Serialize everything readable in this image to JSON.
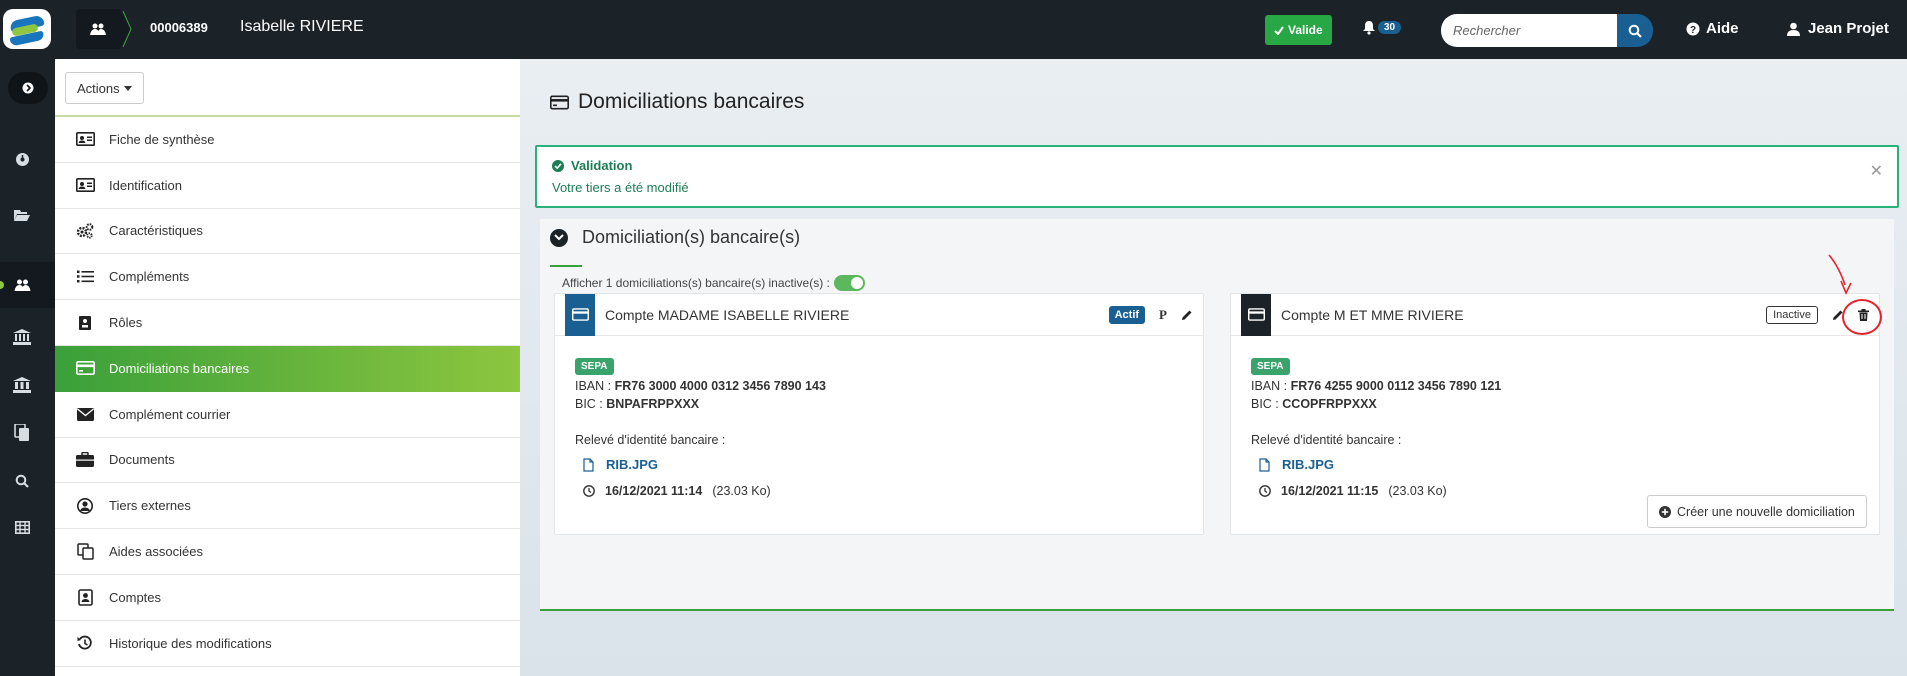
{
  "header": {
    "tiers_number": "00006389",
    "tiers_name": "Isabelle RIVIERE",
    "status_label": "Valide",
    "notifications_count": "30",
    "search_placeholder": "Rechercher",
    "help_label": "Aide",
    "user_name": "Jean Projet"
  },
  "sidebar": {
    "actions_label": "Actions",
    "items": [
      {
        "label": "Fiche de synthèse",
        "icon": "id-card-icon"
      },
      {
        "label": "Identification",
        "icon": "id-card-icon"
      },
      {
        "label": "Caractéristiques",
        "icon": "cogs-icon"
      },
      {
        "label": "Compléments",
        "icon": "list-icon"
      },
      {
        "label": "Rôles",
        "icon": "role-icon"
      },
      {
        "label": "Domiciliations bancaires",
        "icon": "credit-card-icon",
        "active": true
      },
      {
        "label": "Complément courrier",
        "icon": "envelope-icon"
      },
      {
        "label": "Documents",
        "icon": "briefcase-icon"
      },
      {
        "label": "Tiers externes",
        "icon": "user-circle-icon"
      },
      {
        "label": "Aides associées",
        "icon": "copy-icon"
      },
      {
        "label": "Comptes",
        "icon": "address-card-icon"
      },
      {
        "label": "Historique des modifications",
        "icon": "history-icon"
      }
    ]
  },
  "main": {
    "page_title": "Domiciliations bancaires",
    "alert": {
      "title": "Validation",
      "message": "Votre tiers a été modifié"
    },
    "panel": {
      "title": "Domiciliation(s) bancaire(s)",
      "toggle_label": "Afficher 1 domiciliations(s) bancaire(s) inactive(s) :",
      "create_label": "Créer une nouvelle domiciliation"
    },
    "accounts": [
      {
        "title": "Compte MADAME ISABELLE RIVIERE",
        "status": "Actif",
        "principal": "P",
        "type": "SEPA",
        "iban_label": "IBAN :",
        "iban": "FR76 3000 4000 0312 3456 7890 143",
        "bic_label": "BIC :",
        "bic": "BNPAFRPPXXX",
        "rib_label": "Relevé d'identité bancaire :",
        "file_name": "RIB.JPG",
        "date": "16/12/2021 11:14",
        "size": "(23.03 Ko)"
      },
      {
        "title": "Compte M ET MME RIVIERE",
        "status": "Inactive",
        "type": "SEPA",
        "iban_label": "IBAN :",
        "iban": "FR76 4255 9000 0112 3456 7890 121",
        "bic_label": "BIC :",
        "bic": "CCOPFRPPXXX",
        "rib_label": "Relevé d'identité bancaire :",
        "file_name": "RIB.JPG",
        "date": "16/12/2021 11:15",
        "size": "(23.03 Ko)"
      }
    ]
  },
  "colors": {
    "topbar": "#1b2228",
    "accent_green": "#3aa03a",
    "accent_blue": "#1a5f91",
    "alert_green": "#2bb07a",
    "annotation_red": "#e6232a"
  }
}
